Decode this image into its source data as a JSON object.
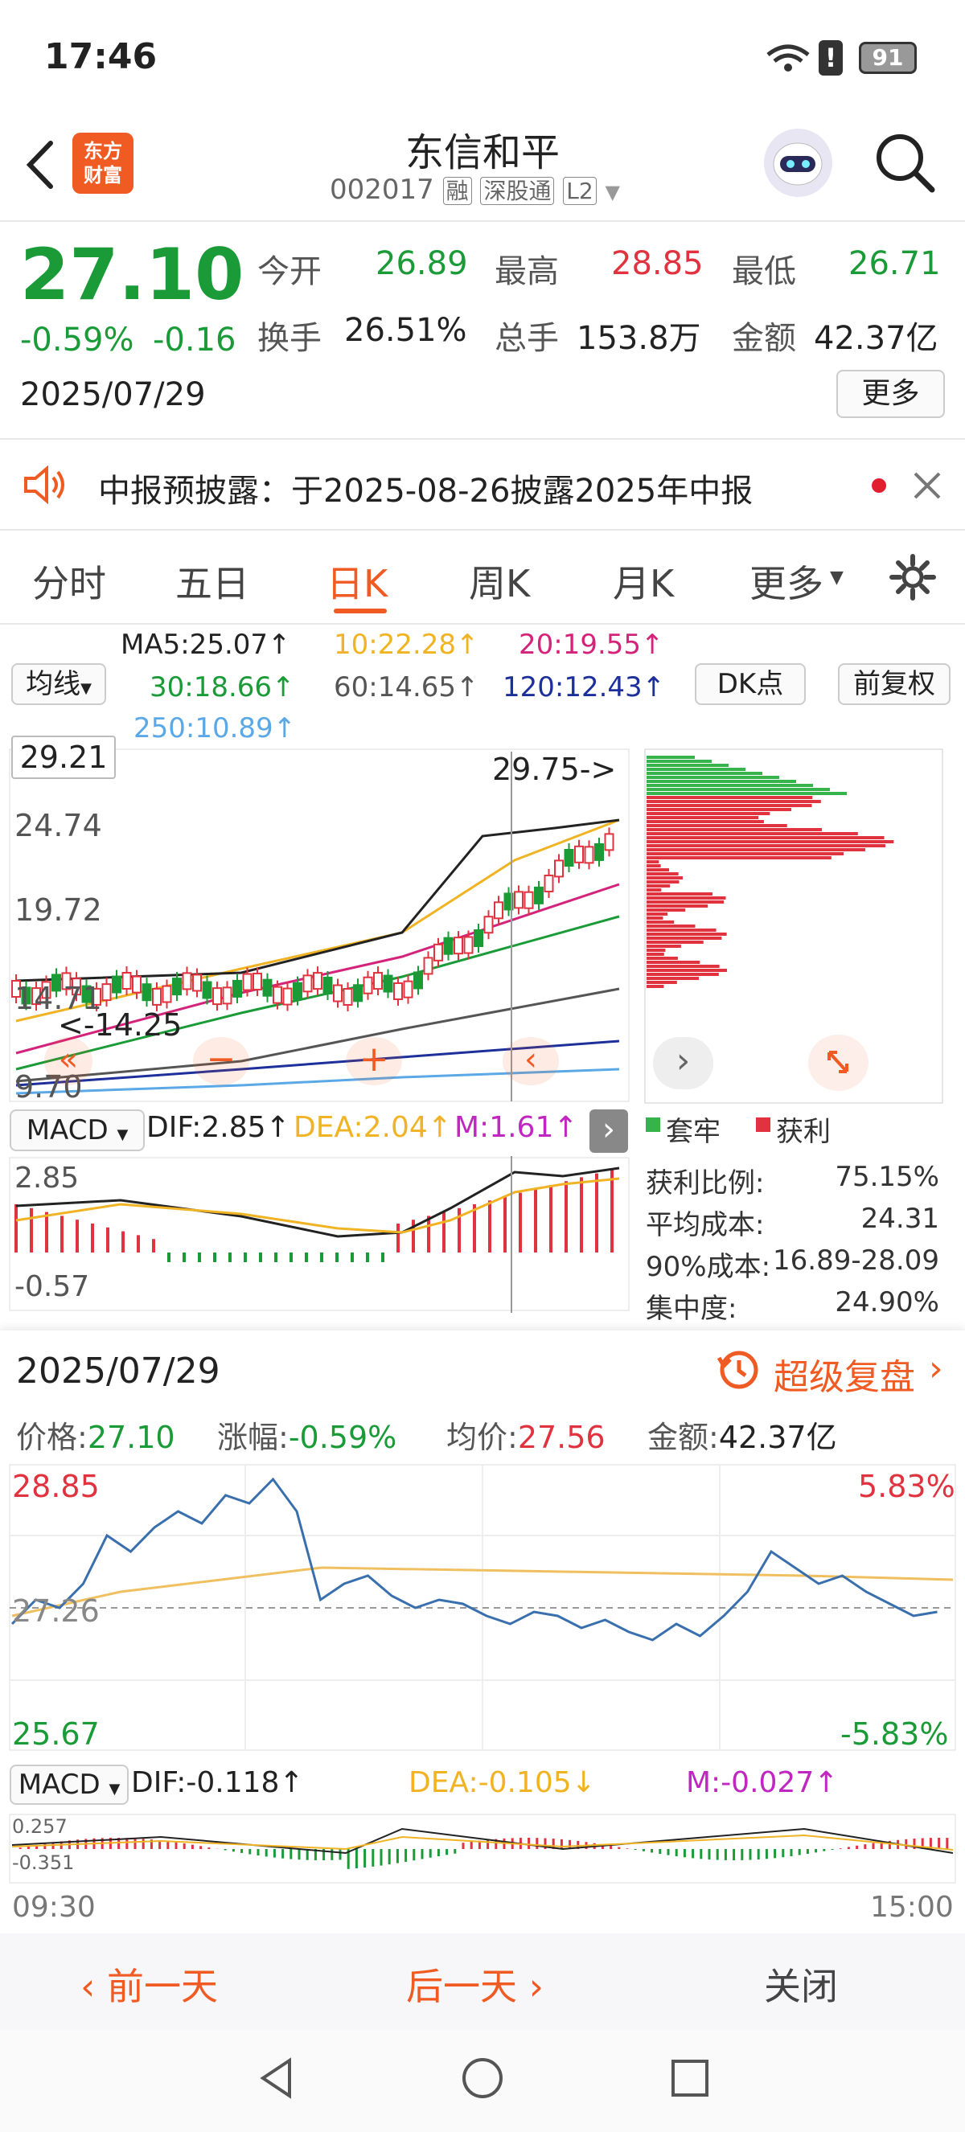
{
  "status": {
    "time": "17:46",
    "battery": "91"
  },
  "header": {
    "logo_line1": "东方",
    "logo_line2": "财富",
    "title": "东信和平",
    "code": "002017",
    "badges": [
      "融",
      "深股通",
      "L2"
    ]
  },
  "quote": {
    "price": "27.10",
    "pct": "-0.59%",
    "chg": "-0.16",
    "date": "2025/07/29",
    "open_label": "今开",
    "open": "26.89",
    "high_label": "最高",
    "high": "28.85",
    "low_label": "最低",
    "low": "26.71",
    "turnover_label": "换手",
    "turnover": "26.51%",
    "volume_label": "总手",
    "volume": "153.8万",
    "amount_label": "金额",
    "amount": "42.37亿",
    "more": "更多"
  },
  "notice": {
    "text": "中报预披露：于2025-08-26披露2025年中报"
  },
  "tabs": {
    "t1": "分时",
    "t2": "五日",
    "t3": "日K",
    "t4": "周K",
    "t5": "月K",
    "t6": "更多",
    "active": "日K"
  },
  "ma": {
    "selector": "均线",
    "ma5": "MA5:25.07↑",
    "ma10": "10:22.28↑",
    "ma20": "20:19.55↑",
    "ma30": "30:18.66↑",
    "ma60": "60:14.65↑",
    "ma120": "120:12.43↑",
    "ma250": "250:10.89↑",
    "dk": "DK点",
    "fq": "前复权",
    "c_ma5": "#222222",
    "c_ma10": "#f0b323",
    "c_ma20": "#d4237a",
    "c_ma30": "#1a9b37",
    "c_ma60": "#555555",
    "c_ma120": "#1d2f9a",
    "c_ma250": "#5aa9e6"
  },
  "kchart": {
    "y_labels": [
      "29.21",
      "24.74",
      "19.72",
      "14.71",
      "9.70"
    ],
    "max_note": "29.75->",
    "min_note": "<-14.25"
  },
  "macd1": {
    "label": "MACD",
    "dif": "DIF:2.85↑",
    "dea": "DEA:2.04↑",
    "m": "M:1.61↑",
    "top": "2.85",
    "bottom": "-0.57"
  },
  "chips": {
    "legend_trapped": "套牢",
    "legend_profit": "获利",
    "rows": [
      {
        "k": "获利比例:",
        "v": "75.15%"
      },
      {
        "k": "平均成本:",
        "v": "24.31"
      },
      {
        "k": "90%成本:",
        "v": "16.89-28.09"
      },
      {
        "k": "集中度:",
        "v": "24.90%"
      }
    ]
  },
  "intraday": {
    "date": "2025/07/29",
    "replay": "超级复盘",
    "price_label": "价格:",
    "price": "27.10",
    "chg_label": "涨幅:",
    "chg": "-0.59%",
    "avg_label": "均价:",
    "avg": "27.56",
    "amt_label": "金额:",
    "amt": "42.37亿",
    "hi": "28.85",
    "lo": "25.67",
    "mid": "27.26",
    "hi_pct": "5.83%",
    "lo_pct": "-5.83%",
    "start": "09:30",
    "end": "15:00"
  },
  "macd2": {
    "label": "MACD",
    "dif": "DIF:-0.118↑",
    "dea": "DEA:-0.105↓",
    "m": "M:-0.027↑",
    "top": "0.257",
    "bottom": "-0.351"
  },
  "footer": {
    "prev": "前一天",
    "next": "后一天",
    "close": "关闭"
  }
}
